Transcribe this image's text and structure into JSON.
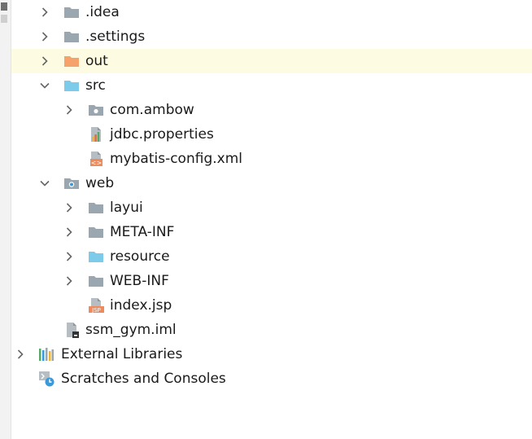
{
  "tree": [
    {
      "label": ".idea",
      "icon": "folder-icon",
      "depth": 2,
      "expandable": true,
      "expanded": false
    },
    {
      "label": ".settings",
      "icon": "folder-icon",
      "depth": 2,
      "expandable": true,
      "expanded": false
    },
    {
      "label": "out",
      "icon": "excluded-folder-icon",
      "depth": 2,
      "expandable": true,
      "expanded": false,
      "highlighted": true
    },
    {
      "label": "src",
      "icon": "source-folder-icon",
      "depth": 2,
      "expandable": true,
      "expanded": true
    },
    {
      "label": "com.ambow",
      "icon": "package-icon",
      "depth": 3,
      "expandable": true,
      "expanded": false
    },
    {
      "label": "jdbc.properties",
      "icon": "properties-file-icon",
      "depth": 3,
      "expandable": false
    },
    {
      "label": "mybatis-config.xml",
      "icon": "xml-file-icon",
      "depth": 3,
      "expandable": false
    },
    {
      "label": "web",
      "icon": "web-folder-icon",
      "depth": 2,
      "expandable": true,
      "expanded": true
    },
    {
      "label": "layui",
      "icon": "folder-icon",
      "depth": 3,
      "expandable": true,
      "expanded": false
    },
    {
      "label": "META-INF",
      "icon": "folder-icon",
      "depth": 3,
      "expandable": true,
      "expanded": false
    },
    {
      "label": "resource",
      "icon": "resource-folder-icon",
      "depth": 3,
      "expandable": true,
      "expanded": false
    },
    {
      "label": "WEB-INF",
      "icon": "folder-icon",
      "depth": 3,
      "expandable": true,
      "expanded": false
    },
    {
      "label": "index.jsp",
      "icon": "jsp-file-icon",
      "depth": 3,
      "expandable": false
    },
    {
      "label": "ssm_gym.iml",
      "icon": "iml-file-icon",
      "depth": 2,
      "expandable": false
    },
    {
      "label": "External Libraries",
      "icon": "libraries-icon",
      "depth": 1,
      "expandable": true,
      "expanded": false
    },
    {
      "label": "Scratches and Consoles",
      "icon": "scratches-icon",
      "depth": 1,
      "expandable": false
    }
  ],
  "icon_text": {
    "xml": "<>",
    "jsp": "JSP"
  },
  "colors": {
    "highlight": "#fdfce3",
    "folder": "#9aa7b0",
    "excluded_folder": "#f6a26b",
    "source_folder": "#7ccbea",
    "file_orange": "#ed8b5c",
    "chevron": "#666666"
  }
}
